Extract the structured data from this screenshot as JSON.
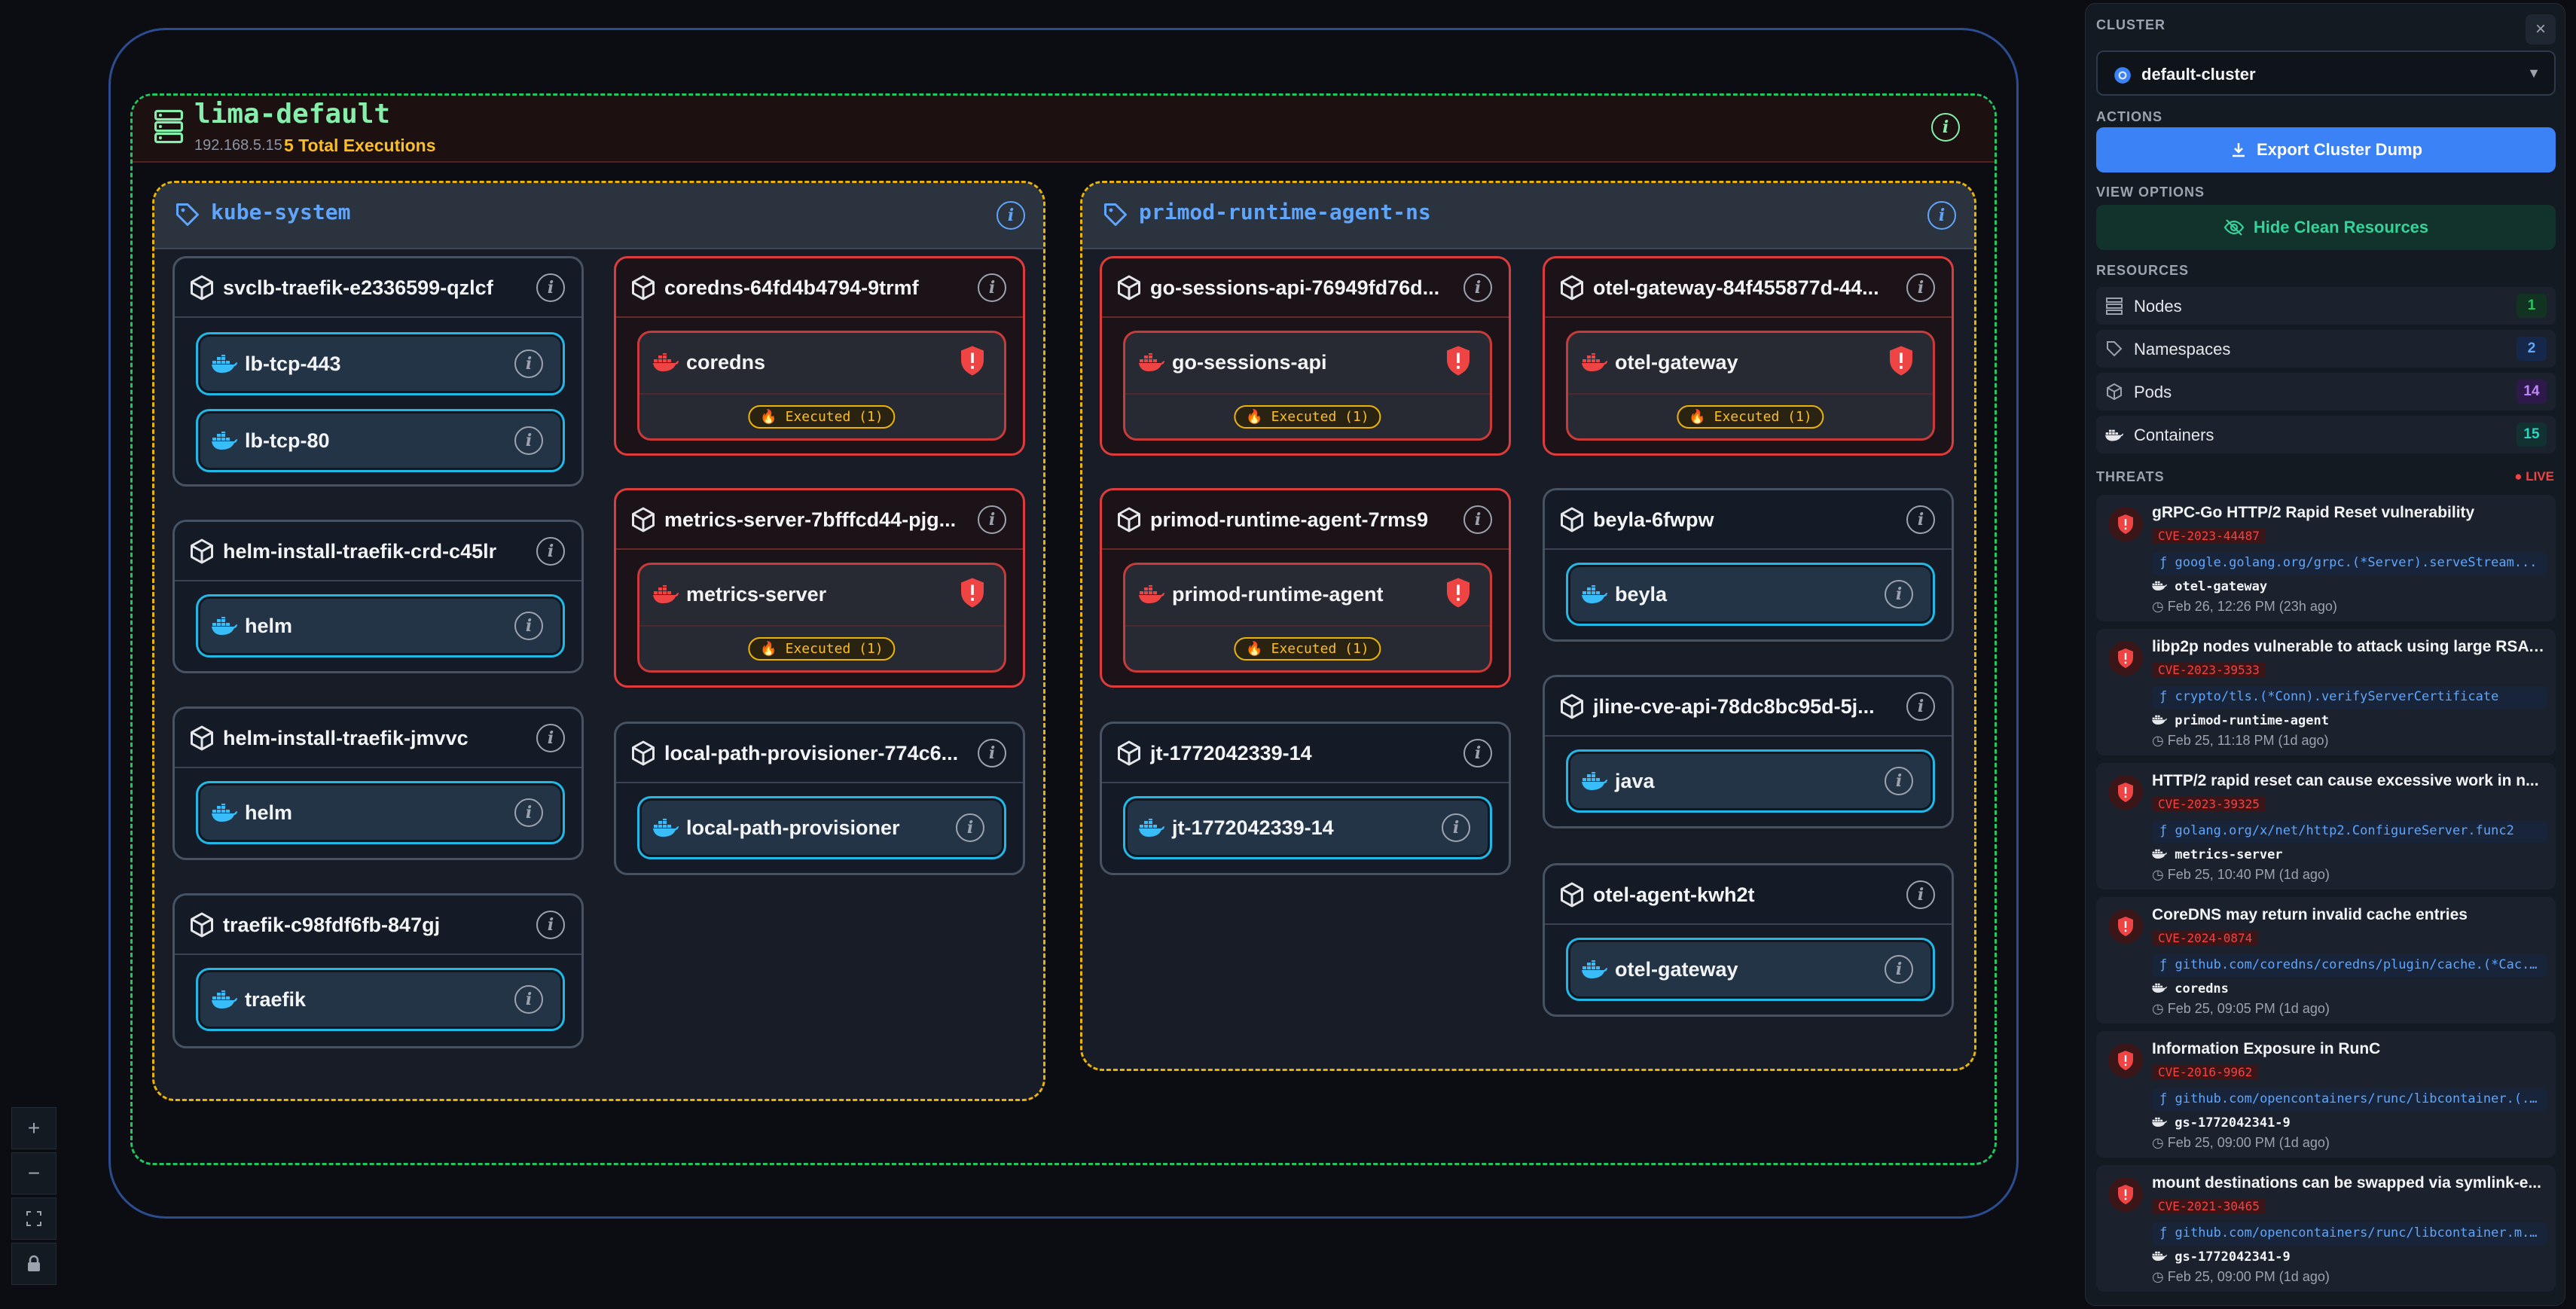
{
  "node": {
    "name": "lima-default",
    "ip": "192.168.5.15",
    "executions": "5 Total Executions"
  },
  "namespaces": [
    {
      "name": "kube-system"
    },
    {
      "name": "primod-runtime-agent-ns"
    }
  ],
  "pods": [
    {
      "name": "svclb-traefik-e2336599-qzlcf",
      "containers": [
        {
          "name": "lb-tcp-443"
        },
        {
          "name": "lb-tcp-80"
        }
      ]
    },
    {
      "name": "helm-install-traefik-crd-c45lr",
      "containers": [
        {
          "name": "helm"
        }
      ]
    },
    {
      "name": "helm-install-traefik-jmvvc",
      "containers": [
        {
          "name": "helm"
        }
      ]
    },
    {
      "name": "traefik-c98fdf6fb-847gj",
      "containers": [
        {
          "name": "traefik"
        }
      ]
    },
    {
      "name": "coredns-64fd4b4794-9trmf",
      "containers": [
        {
          "name": "coredns",
          "executed": "Executed (1)"
        }
      ]
    },
    {
      "name": "metrics-server-7bfffcd44-pjg...",
      "containers": [
        {
          "name": "metrics-server",
          "executed": "Executed (1)"
        }
      ]
    },
    {
      "name": "local-path-provisioner-774c6...",
      "containers": [
        {
          "name": "local-path-provisioner"
        }
      ]
    },
    {
      "name": "go-sessions-api-76949fd76d...",
      "containers": [
        {
          "name": "go-sessions-api",
          "executed": "Executed (1)"
        }
      ]
    },
    {
      "name": "primod-runtime-agent-7rms9",
      "containers": [
        {
          "name": "primod-runtime-agent",
          "executed": "Executed (1)"
        }
      ]
    },
    {
      "name": "jt-1772042339-14",
      "containers": [
        {
          "name": "jt-1772042339-14"
        }
      ]
    },
    {
      "name": "otel-gateway-84f455877d-44...",
      "containers": [
        {
          "name": "otel-gateway",
          "executed": "Executed (1)"
        }
      ]
    },
    {
      "name": "beyla-6fwpw",
      "containers": [
        {
          "name": "beyla"
        }
      ]
    },
    {
      "name": "jline-cve-api-78dc8bc95d-5j...",
      "containers": [
        {
          "name": "java"
        }
      ]
    },
    {
      "name": "otel-agent-kwh2t",
      "containers": [
        {
          "name": "otel-gateway"
        }
      ]
    }
  ],
  "sidebar": {
    "cluster_label": "CLUSTER",
    "cluster_value": "default-cluster",
    "actions_label": "ACTIONS",
    "export_label": "Export Cluster Dump",
    "view_label": "VIEW OPTIONS",
    "hide_label": "Hide Clean Resources",
    "resources_label": "RESOURCES",
    "resources": [
      {
        "label": "Nodes",
        "count": "1",
        "color": "#22c55e"
      },
      {
        "label": "Namespaces",
        "count": "2",
        "color": "#3b82f6"
      },
      {
        "label": "Pods",
        "count": "14",
        "color": "#a855f7"
      },
      {
        "label": "Containers",
        "count": "15",
        "color": "#14b8a6"
      }
    ],
    "threats_label": "THREATS",
    "live_label": "LIVE",
    "threats": [
      {
        "title": "gRPC-Go HTTP/2 Rapid Reset vulnerability",
        "cve": "CVE-2023-44487",
        "fn": "google.golang.org/grpc.(*Server).serveStream...",
        "container": "otel-gateway",
        "time": "Feb 26, 12:26 PM (23h ago)"
      },
      {
        "title": "libp2p nodes vulnerable to attack using large RSA ...",
        "cve": "CVE-2023-39533",
        "fn": "crypto/tls.(*Conn).verifyServerCertificate",
        "container": "primod-runtime-agent",
        "time": "Feb 25, 11:18 PM (1d ago)"
      },
      {
        "title": "HTTP/2 rapid reset can cause excessive work in n...",
        "cve": "CVE-2023-39325",
        "fn": "golang.org/x/net/http2.ConfigureServer.func2",
        "container": "metrics-server",
        "time": "Feb 25, 10:40 PM (1d ago)"
      },
      {
        "title": "CoreDNS may return invalid cache entries",
        "cve": "CVE-2024-0874",
        "fn": "github.com/coredns/coredns/plugin/cache.(*Cac...",
        "container": "coredns",
        "time": "Feb 25, 09:05 PM (1d ago)"
      },
      {
        "title": "Information Exposure in RunC",
        "cve": "CVE-2016-9962",
        "fn": "github.com/opencontainers/runc/libcontainer.(...",
        "container": "gs-1772042341-9",
        "time": "Feb 25, 09:00 PM (1d ago)"
      },
      {
        "title": "mount destinations can be swapped via symlink-e...",
        "cve": "CVE-2021-30465",
        "fn": "github.com/opencontainers/runc/libcontainer.m...",
        "container": "gs-1772042341-9",
        "time": "Feb 25, 09:00 PM (1d ago)"
      }
    ]
  },
  "controls": {
    "zoom_in": "+",
    "zoom_out": "−"
  }
}
